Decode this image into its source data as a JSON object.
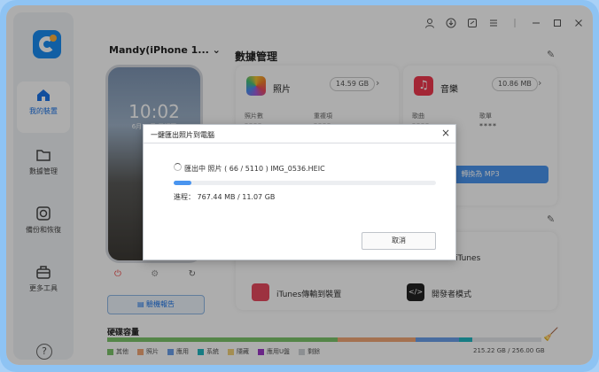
{
  "sidebar": {
    "items": [
      {
        "label": "我的裝置",
        "icon": "home-icon",
        "active": true
      },
      {
        "label": "數據管理",
        "icon": "folder-icon",
        "active": false
      },
      {
        "label": "備份和恢復",
        "icon": "backup-icon",
        "active": false
      },
      {
        "label": "更多工具",
        "icon": "toolbox-icon",
        "active": false
      }
    ],
    "help": "?"
  },
  "device": {
    "name": "Mandy(iPhone 1...",
    "time": "10:02",
    "date": "6月19日 星期四",
    "report_label": "驗機報告"
  },
  "data_manage": {
    "title": "數據管理",
    "photos": {
      "title": "照片",
      "size": "14.59 GB",
      "k1": "照片數",
      "k2": "重複項",
      "v1": "****",
      "v2": "****"
    },
    "music": {
      "title": "音樂",
      "size": "10.86 MB",
      "k1": "歌曲",
      "k2": "歌單",
      "v1": "****",
      "v2": "****",
      "convert": "轉換為 MP3"
    }
  },
  "tools": {
    "itunes": "iTunes",
    "transfer": "iTunes傳輸到裝置",
    "dev_mode": "開發者模式"
  },
  "storage": {
    "title": "硬碟容量",
    "total": "215.22 GB / 256.00 GB",
    "legend": [
      "其他",
      "照片",
      "應用",
      "系統",
      "隱藏",
      "應用U盤",
      "剩餘"
    ],
    "segments": [
      {
        "name": "其他",
        "value": 0.53,
        "color": "#7cc56b"
      },
      {
        "name": "照片",
        "value": 0.18,
        "color": "#f2a776"
      },
      {
        "name": "應用",
        "value": 0.1,
        "color": "#6ba0ea"
      },
      {
        "name": "系統",
        "value": 0.03,
        "color": "#23b7c2"
      },
      {
        "name": "隱藏",
        "value": 0.0,
        "color": "#f2d27a"
      },
      {
        "name": "應用U盤",
        "value": 0.0,
        "color": "#9c39c8"
      },
      {
        "name": "剩餘",
        "value": 0.16,
        "color": "#e3e6ea"
      }
    ]
  },
  "dialog": {
    "title": "一鍵匯出照片到電腦",
    "status": "匯出中 照片 ( 66 / 5110 ) IMG_0536.HEIC",
    "progress_text": "進程： 767.44 MB / 11.07 GB",
    "progress": 0.068,
    "cancel": "取消"
  }
}
